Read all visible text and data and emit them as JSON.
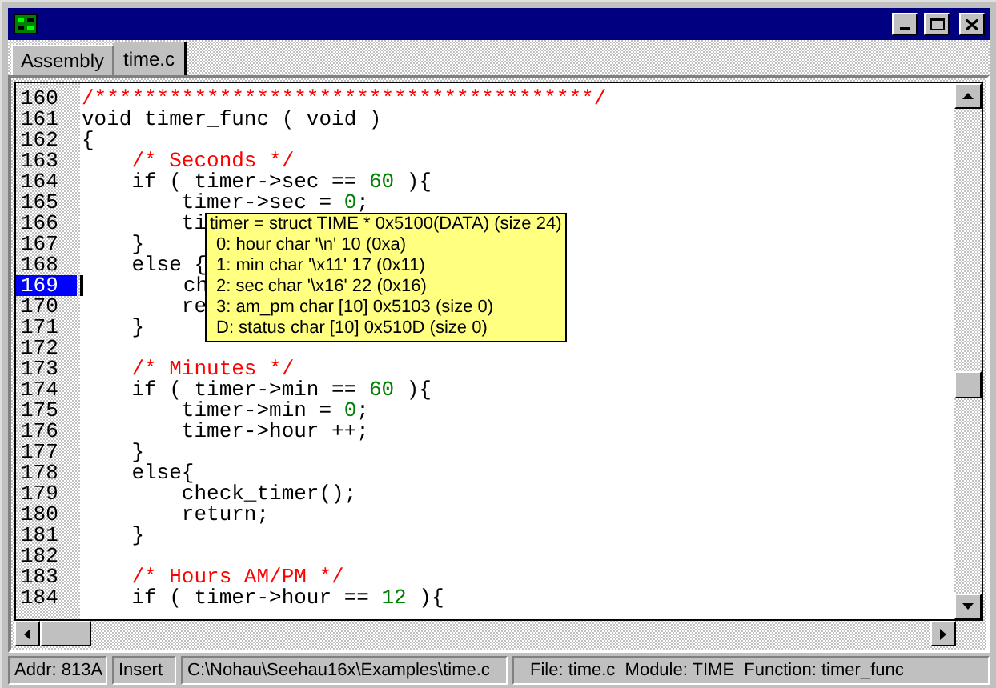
{
  "tabs": [
    {
      "label": "Assembly",
      "selected": false
    },
    {
      "label": "time.c",
      "selected": true
    }
  ],
  "code_lines": [
    {
      "number": "160",
      "current": false,
      "tokens": [
        {
          "kind": "comment",
          "text": "/****************************************/"
        }
      ]
    },
    {
      "number": "161",
      "current": false,
      "tokens": [
        {
          "kind": "plain",
          "text": "void timer_func ( void )"
        }
      ]
    },
    {
      "number": "162",
      "current": false,
      "tokens": [
        {
          "kind": "plain",
          "text": "{"
        }
      ]
    },
    {
      "number": "163",
      "current": false,
      "tokens": [
        {
          "kind": "comment",
          "text": "    /* Seconds */"
        }
      ]
    },
    {
      "number": "164",
      "current": false,
      "tokens": [
        {
          "kind": "plain",
          "text": "    if ( timer->sec == "
        },
        {
          "kind": "number",
          "text": "60"
        },
        {
          "kind": "plain",
          "text": " ){"
        }
      ]
    },
    {
      "number": "165",
      "current": false,
      "tokens": [
        {
          "kind": "plain",
          "text": "        timer->sec = "
        },
        {
          "kind": "number",
          "text": "0"
        },
        {
          "kind": "plain",
          "text": ";"
        }
      ]
    },
    {
      "number": "166",
      "current": false,
      "tokens": [
        {
          "kind": "plain",
          "text": "        ti"
        }
      ]
    },
    {
      "number": "167",
      "current": false,
      "tokens": [
        {
          "kind": "plain",
          "text": "    }"
        }
      ]
    },
    {
      "number": "168",
      "current": false,
      "tokens": [
        {
          "kind": "plain",
          "text": "    else {"
        }
      ]
    },
    {
      "number": "169",
      "current": true,
      "tokens": [
        {
          "kind": "plain",
          "text": "        ch"
        }
      ]
    },
    {
      "number": "170",
      "current": false,
      "tokens": [
        {
          "kind": "plain",
          "text": "        re"
        }
      ]
    },
    {
      "number": "171",
      "current": false,
      "tokens": [
        {
          "kind": "plain",
          "text": "    }"
        }
      ]
    },
    {
      "number": "172",
      "current": false
    },
    {
      "number": "173",
      "current": false,
      "tokens": [
        {
          "kind": "comment",
          "text": "    /* Minutes */"
        }
      ]
    },
    {
      "number": "174",
      "current": false,
      "tokens": [
        {
          "kind": "plain",
          "text": "    if ( timer->min == "
        },
        {
          "kind": "number",
          "text": "60"
        },
        {
          "kind": "plain",
          "text": " ){"
        }
      ]
    },
    {
      "number": "175",
      "current": false,
      "tokens": [
        {
          "kind": "plain",
          "text": "        timer->min = "
        },
        {
          "kind": "number",
          "text": "0"
        },
        {
          "kind": "plain",
          "text": ";"
        }
      ]
    },
    {
      "number": "176",
      "current": false,
      "tokens": [
        {
          "kind": "plain",
          "text": "        timer->hour ++;"
        }
      ]
    },
    {
      "number": "177",
      "current": false,
      "tokens": [
        {
          "kind": "plain",
          "text": "    }"
        }
      ]
    },
    {
      "number": "178",
      "current": false,
      "tokens": [
        {
          "kind": "plain",
          "text": "    else{"
        }
      ]
    },
    {
      "number": "179",
      "current": false,
      "tokens": [
        {
          "kind": "plain",
          "text": "        check_timer();"
        }
      ]
    },
    {
      "number": "180",
      "current": false,
      "tokens": [
        {
          "kind": "plain",
          "text": "        return;"
        }
      ]
    },
    {
      "number": "181",
      "current": false,
      "tokens": [
        {
          "kind": "plain",
          "text": "    }"
        }
      ]
    },
    {
      "number": "182",
      "current": false
    },
    {
      "number": "183",
      "current": false,
      "tokens": [
        {
          "kind": "comment",
          "text": "    /* Hours AM/PM */"
        }
      ]
    },
    {
      "number": "184",
      "current": false,
      "tokens": [
        {
          "kind": "plain",
          "text": "    if ( timer->hour == "
        },
        {
          "kind": "number",
          "text": "12"
        },
        {
          "kind": "plain",
          "text": " ){"
        }
      ]
    }
  ],
  "tooltip": {
    "title": "timer = struct TIME * 0x5100(DATA) (size 24)",
    "fields": [
      "0: hour char '\\n' 10 (0xa)",
      "1: min char '\\x11' 17 (0x11)",
      "2: sec char '\\x16' 22 (0x16)",
      "3: am_pm char [10] 0x5103 (size 0)",
      "D: status char [10] 0x510D (size 0)"
    ]
  },
  "status_bar": [
    "Addr: 813A",
    "Insert",
    "C:\\Nohau\\Seehau16x\\Examples\\time.c",
    "File: time.c  Module: TIME  Function: timer_func"
  ]
}
